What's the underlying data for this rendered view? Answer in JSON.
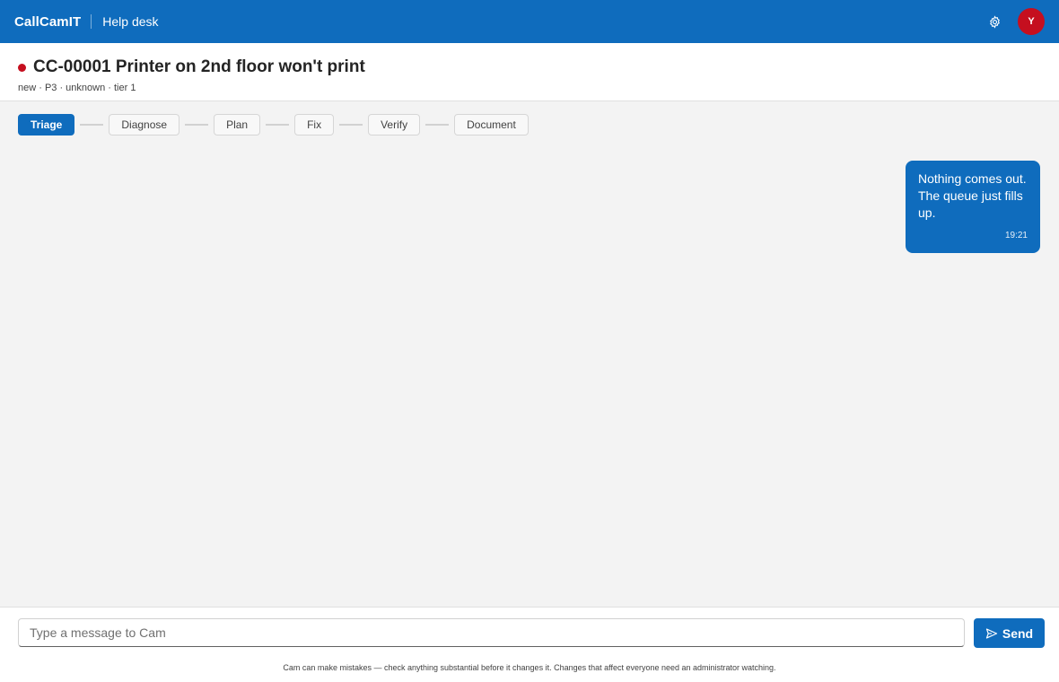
{
  "header": {
    "brand": "CallCamIT",
    "section": "Help desk",
    "avatar_initial": "Y",
    "settings_icon": "gear-icon",
    "accent_color": "#0f6cbd",
    "avatar_color": "#c50f1f"
  },
  "ticket": {
    "title": "CC-00001 Printer on 2nd floor won't print",
    "meta": "new · P3 · unknown · tier 1",
    "status_color": "#c50f1f"
  },
  "stages": {
    "active": "Triage",
    "items": [
      "Triage",
      "Diagnose",
      "Plan",
      "Fix",
      "Verify",
      "Document"
    ]
  },
  "messages": [
    {
      "sender": "user",
      "text": "Nothing comes out. The queue just fills up.",
      "time": "19:21"
    }
  ],
  "composer": {
    "placeholder": "Type a message to Cam",
    "value": "",
    "send_label": "Send",
    "send_icon": "send-icon",
    "disclaimer": "Cam can make mistakes — check anything substantial before it changes it. Changes that affect everyone need an administrator watching."
  }
}
